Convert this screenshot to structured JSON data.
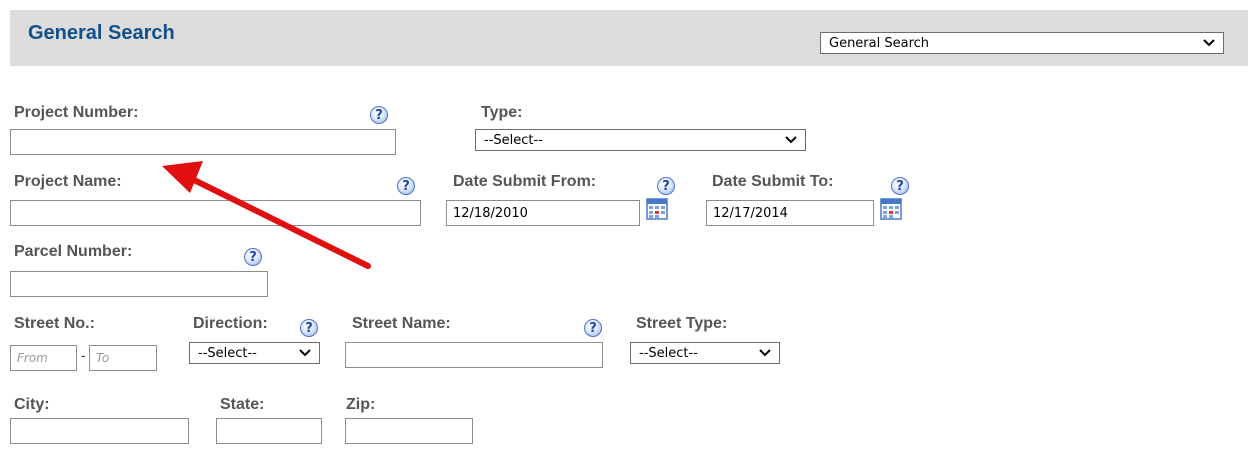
{
  "header": {
    "title": "General Search",
    "dropdown_value": "General Search"
  },
  "form": {
    "project_number_label": "Project Number:",
    "type_label": "Type:",
    "type_value": "--Select--",
    "project_name_label": "Project Name:",
    "date_from_label": "Date Submit From:",
    "date_from_value": "12/18/2010",
    "date_to_label": "Date Submit To:",
    "date_to_value": "12/17/2014",
    "parcel_number_label": "Parcel Number:",
    "street_no_label": "Street No.:",
    "street_no_from_placeholder": "From",
    "street_no_to_placeholder": "To",
    "street_no_separator": "-",
    "direction_label": "Direction:",
    "direction_value": "--Select--",
    "street_name_label": "Street Name:",
    "street_type_label": "Street Type:",
    "street_type_value": "--Select--",
    "city_label": "City:",
    "state_label": "State:",
    "zip_label": "Zip:"
  },
  "help_icon_glyph": "?",
  "colors": {
    "header_bg": "#dcdcdc",
    "header_title": "#12508b",
    "label": "#555555",
    "annotation_arrow": "#e01010"
  }
}
